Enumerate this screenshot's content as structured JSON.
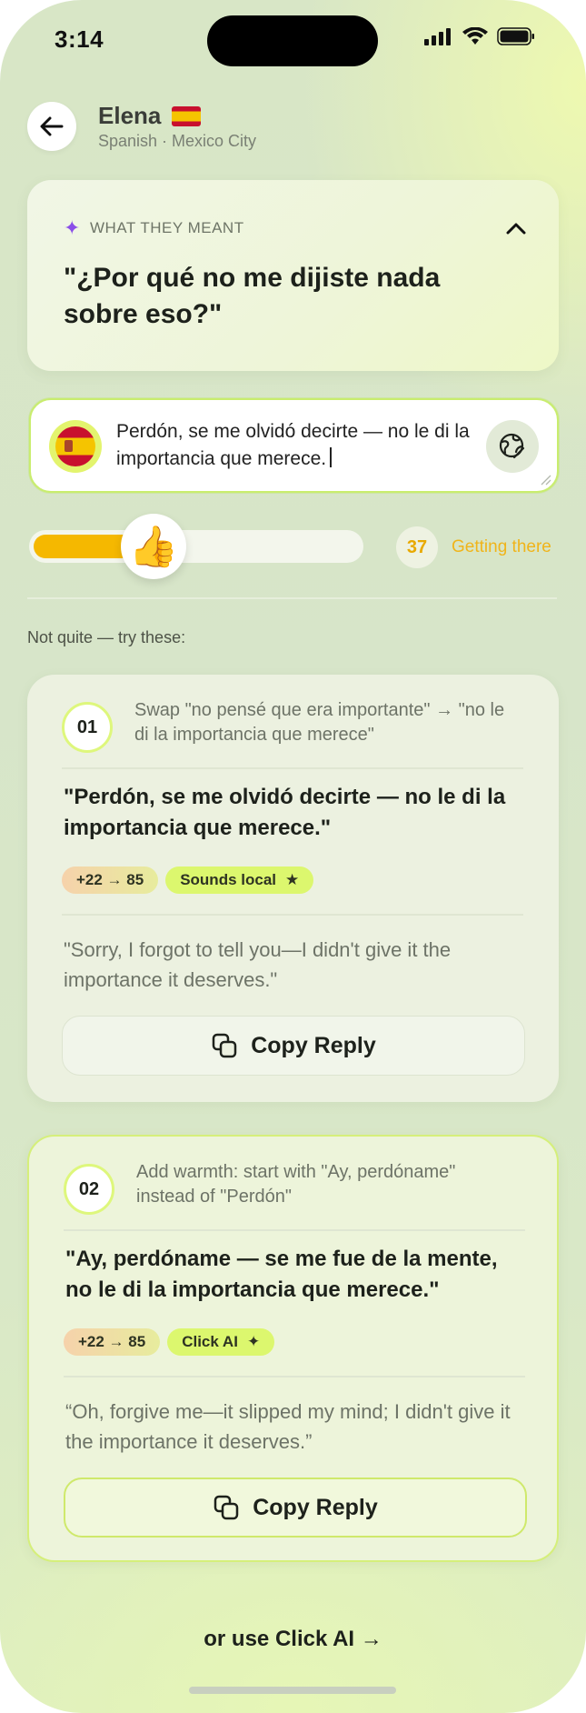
{
  "status_bar": {
    "time": "3:14"
  },
  "header": {
    "name": "Elena",
    "subtitle": "Spanish · Mexico City"
  },
  "meaning_card": {
    "label": "WHAT THEY MEANT",
    "text": "\"¿Por qué no me dijiste nada sobre eso?\""
  },
  "input": {
    "value": "Perdón, se me olvidó decirte — no le di la importancia que merece."
  },
  "score": {
    "value": "37",
    "fraction": 0.37,
    "status": "Getting there"
  },
  "suggestions_label": "Not quite — try these:",
  "suggestions": [
    {
      "number": "01",
      "tip": "Swap \"no pensé que era importante\" → \"no le di la importancia que merece\"",
      "quote": "\"Perdón, se me olvidó decirte — no le di la importancia que merece.\"",
      "score_tag": "+22 → 85",
      "accent_tag": "Sounds local",
      "translation": "\"Sorry, I forgot to tell you—I didn't give it the importance it deserves.\"",
      "copy_label": "Copy Reply"
    },
    {
      "number": "02",
      "tip": "Add warmth: start with \"Ay, perdóname\" instead of \"Perdón\"",
      "quote": "\"Ay, perdóname — se me fue de la mente, no le di la importancia que merece.\"",
      "score_tag": "+22 → 85",
      "accent_tag": "Click AI",
      "translation": "“Oh, forgive me—it slipped my mind; I didn't give it the importance it deserves.”",
      "copy_label": "Copy Reply"
    }
  ],
  "footer_link": "or use Click AI →",
  "colors": {
    "accent_lime": "#dcf76e",
    "score_yellow": "#f5b800",
    "sparkle_purple": "#8a4ee8"
  }
}
